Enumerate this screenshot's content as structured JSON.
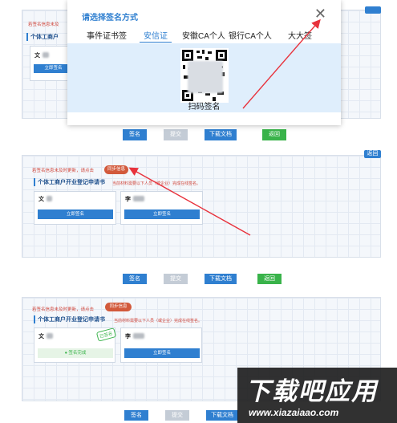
{
  "modal": {
    "title": "请选择签名方式",
    "close_glyph": "✕",
    "tabs": [
      "事件证书签",
      "安信证",
      "安徽CA个人",
      "银行CA个人",
      "大大签"
    ],
    "active_tab": "安信证",
    "qr_label": "扫码签名"
  },
  "panel1": {
    "notice": "若签名信息未及",
    "form_title": "个体工商户",
    "card_name": "文",
    "sign_label": "立即签名",
    "buttons": [
      "签名",
      "提交",
      "下载文档",
      "返回"
    ]
  },
  "panel2": {
    "notice": "若签名信息未及时更新，请点击",
    "sync_label": "同步信息",
    "corner_label": "返回",
    "form_title": "个体工商户开业登记申请书",
    "form_hint": "当前材料需要以下人员（或企业）完成在线签名。",
    "cards": [
      {
        "name": "文",
        "sign_label": "立即签名"
      },
      {
        "name": "李",
        "sign_label": "立即签名"
      }
    ],
    "buttons": [
      "签名",
      "提交",
      "下载文档",
      "返回"
    ]
  },
  "panel3": {
    "notice": "若签名信息未及时更新，请点击",
    "sync_label": "同步信息",
    "form_title": "个体工商户开业登记申请书",
    "form_hint": "当前材料需要以下人员（或企业）完成在线签名。",
    "cards": [
      {
        "name": "文",
        "status": "● 签名完成",
        "stamp": "已签名"
      },
      {
        "name": "李",
        "sign_label": "立即签名"
      }
    ],
    "buttons": [
      "签名",
      "提交",
      "下载文档"
    ]
  },
  "watermark": {
    "main": "下载吧应用",
    "url": "www.xiazaiaao.com"
  },
  "colors": {
    "accent": "#2f7fd0",
    "warning": "#d0453a",
    "success": "#39b34a",
    "arrow": "#e8323c"
  }
}
